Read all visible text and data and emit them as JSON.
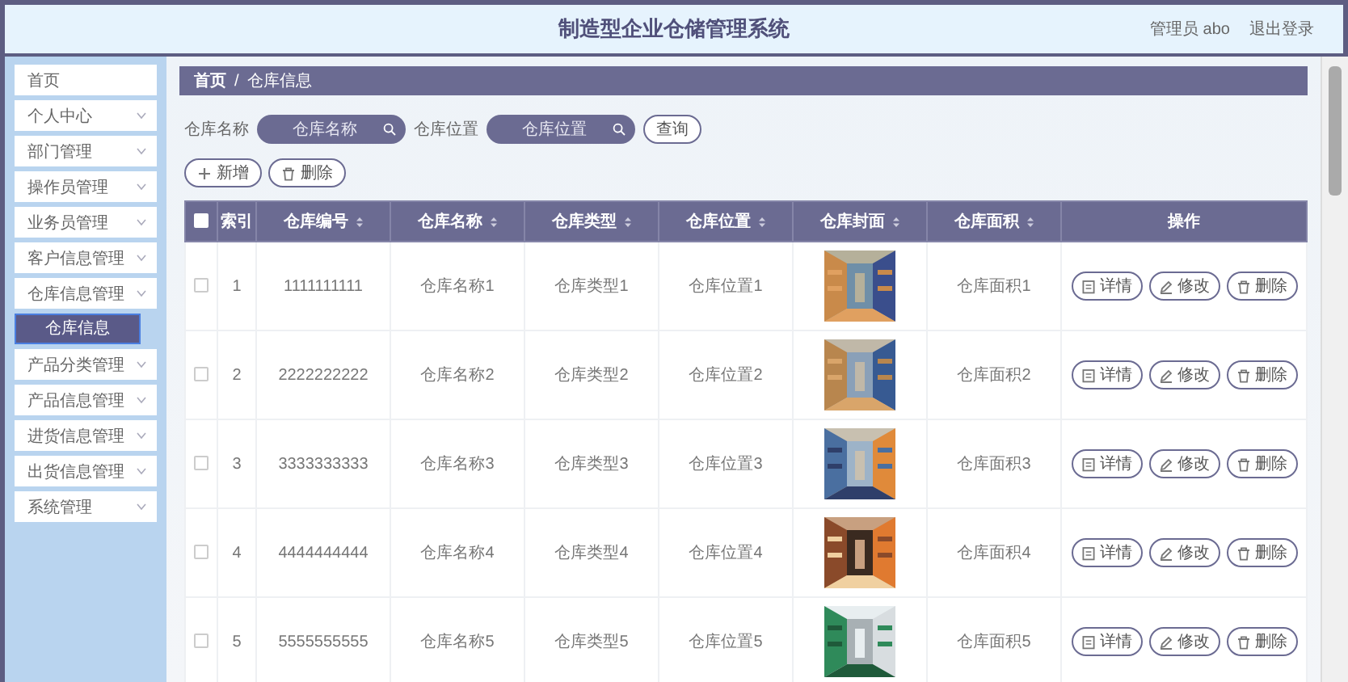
{
  "header": {
    "title": "制造型企业仓储管理系统",
    "user": "管理员 abo",
    "logout": "退出登录"
  },
  "sidebar": {
    "items": [
      {
        "label": "首页",
        "kind": "link"
      },
      {
        "label": "个人中心",
        "kind": "menu"
      },
      {
        "label": "部门管理",
        "kind": "menu"
      },
      {
        "label": "操作员管理",
        "kind": "menu"
      },
      {
        "label": "业务员管理",
        "kind": "menu"
      },
      {
        "label": "客户信息管理",
        "kind": "menu"
      },
      {
        "label": "仓库信息管理",
        "kind": "menu",
        "children": [
          {
            "label": "仓库信息",
            "selected": true
          }
        ]
      },
      {
        "label": "产品分类管理",
        "kind": "menu"
      },
      {
        "label": "产品信息管理",
        "kind": "menu"
      },
      {
        "label": "进货信息管理",
        "kind": "menu"
      },
      {
        "label": "出货信息管理",
        "kind": "menu"
      },
      {
        "label": "系统管理",
        "kind": "menu"
      }
    ]
  },
  "breadcrumb": {
    "items": [
      "首页",
      "仓库信息"
    ],
    "separator": "/"
  },
  "search": {
    "fields": [
      {
        "label": "仓库名称",
        "placeholder": "仓库名称"
      },
      {
        "label": "仓库位置",
        "placeholder": "仓库位置"
      }
    ],
    "button": "查询"
  },
  "actions": [
    {
      "label": "新增",
      "kind": "add"
    },
    {
      "label": "删除",
      "kind": "delete"
    }
  ],
  "table": {
    "select_all": {
      "checked": false
    },
    "columns": [
      {
        "label": "索引",
        "sortable": false
      },
      {
        "label": "仓库编号",
        "sortable": true
      },
      {
        "label": "仓库名称",
        "sortable": true
      },
      {
        "label": "仓库类型",
        "sortable": true
      },
      {
        "label": "仓库位置",
        "sortable": true
      },
      {
        "label": "仓库封面",
        "sortable": true
      },
      {
        "label": "仓库面积",
        "sortable": true
      },
      {
        "label": "操作",
        "sortable": false
      }
    ],
    "rows": [
      {
        "checked": false,
        "index": "1",
        "number": "1111111111",
        "name": "仓库名称1",
        "type": "仓库类型1",
        "location": "仓库位置1",
        "area": "仓库面积1",
        "actions": [
          {
            "label": "详情",
            "kind": "detail"
          },
          {
            "label": "修改",
            "kind": "edit"
          },
          {
            "label": "删除",
            "kind": "delete"
          }
        ]
      },
      {
        "checked": false,
        "index": "2",
        "number": "2222222222",
        "name": "仓库名称2",
        "type": "仓库类型2",
        "location": "仓库位置2",
        "area": "仓库面积2",
        "actions": [
          {
            "label": "详情",
            "kind": "detail"
          },
          {
            "label": "修改",
            "kind": "edit"
          },
          {
            "label": "删除",
            "kind": "delete"
          }
        ]
      },
      {
        "checked": false,
        "index": "3",
        "number": "3333333333",
        "name": "仓库名称3",
        "type": "仓库类型3",
        "location": "仓库位置3",
        "area": "仓库面积3",
        "actions": [
          {
            "label": "详情",
            "kind": "detail"
          },
          {
            "label": "修改",
            "kind": "edit"
          },
          {
            "label": "删除",
            "kind": "delete"
          }
        ]
      },
      {
        "checked": false,
        "index": "4",
        "number": "4444444444",
        "name": "仓库名称4",
        "type": "仓库类型4",
        "location": "仓库位置4",
        "area": "仓库面积4",
        "actions": [
          {
            "label": "详情",
            "kind": "detail"
          },
          {
            "label": "修改",
            "kind": "edit"
          },
          {
            "label": "删除",
            "kind": "delete"
          }
        ]
      },
      {
        "checked": false,
        "index": "5",
        "number": "5555555555",
        "name": "仓库名称5",
        "type": "仓库类型5",
        "location": "仓库位置5",
        "area": "仓库面积5",
        "actions": [
          {
            "label": "详情",
            "kind": "detail"
          },
          {
            "label": "修改",
            "kind": "edit"
          },
          {
            "label": "删除",
            "kind": "delete"
          }
        ]
      }
    ]
  }
}
